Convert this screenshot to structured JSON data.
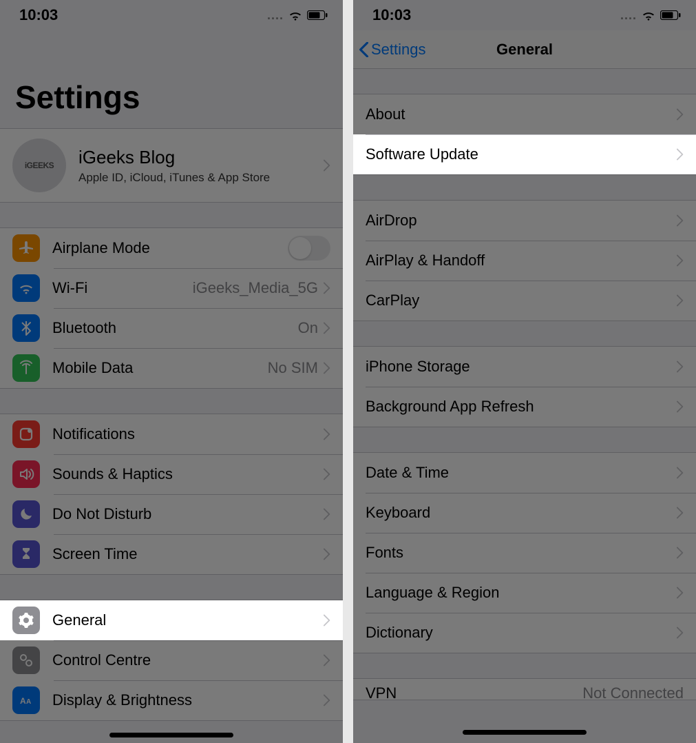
{
  "status": {
    "time": "10:03"
  },
  "left": {
    "title": "Settings",
    "apple_id": {
      "avatar_text": "iGEEKS",
      "name": "iGeeks Blog",
      "subtitle": "Apple ID, iCloud, iTunes & App Store"
    },
    "group1": {
      "airplane": "Airplane Mode",
      "wifi": "Wi-Fi",
      "wifi_value": "iGeeks_Media_5G",
      "bluetooth": "Bluetooth",
      "bluetooth_value": "On",
      "mobile_data": "Mobile Data",
      "mobile_data_value": "No SIM"
    },
    "group2": {
      "notifications": "Notifications",
      "sounds": "Sounds & Haptics",
      "dnd": "Do Not Disturb",
      "screen_time": "Screen Time"
    },
    "group3": {
      "general": "General",
      "control_centre": "Control Centre",
      "display": "Display & Brightness"
    }
  },
  "right": {
    "back": "Settings",
    "title": "General",
    "g1": {
      "about": "About",
      "software_update": "Software Update"
    },
    "g2": {
      "airdrop": "AirDrop",
      "airplay": "AirPlay & Handoff",
      "carplay": "CarPlay"
    },
    "g3": {
      "storage": "iPhone Storage",
      "bg_refresh": "Background App Refresh"
    },
    "g4": {
      "date_time": "Date & Time",
      "keyboard": "Keyboard",
      "fonts": "Fonts",
      "language": "Language & Region",
      "dictionary": "Dictionary"
    },
    "g5": {
      "vpn": "VPN",
      "vpn_value": "Not Connected"
    }
  }
}
